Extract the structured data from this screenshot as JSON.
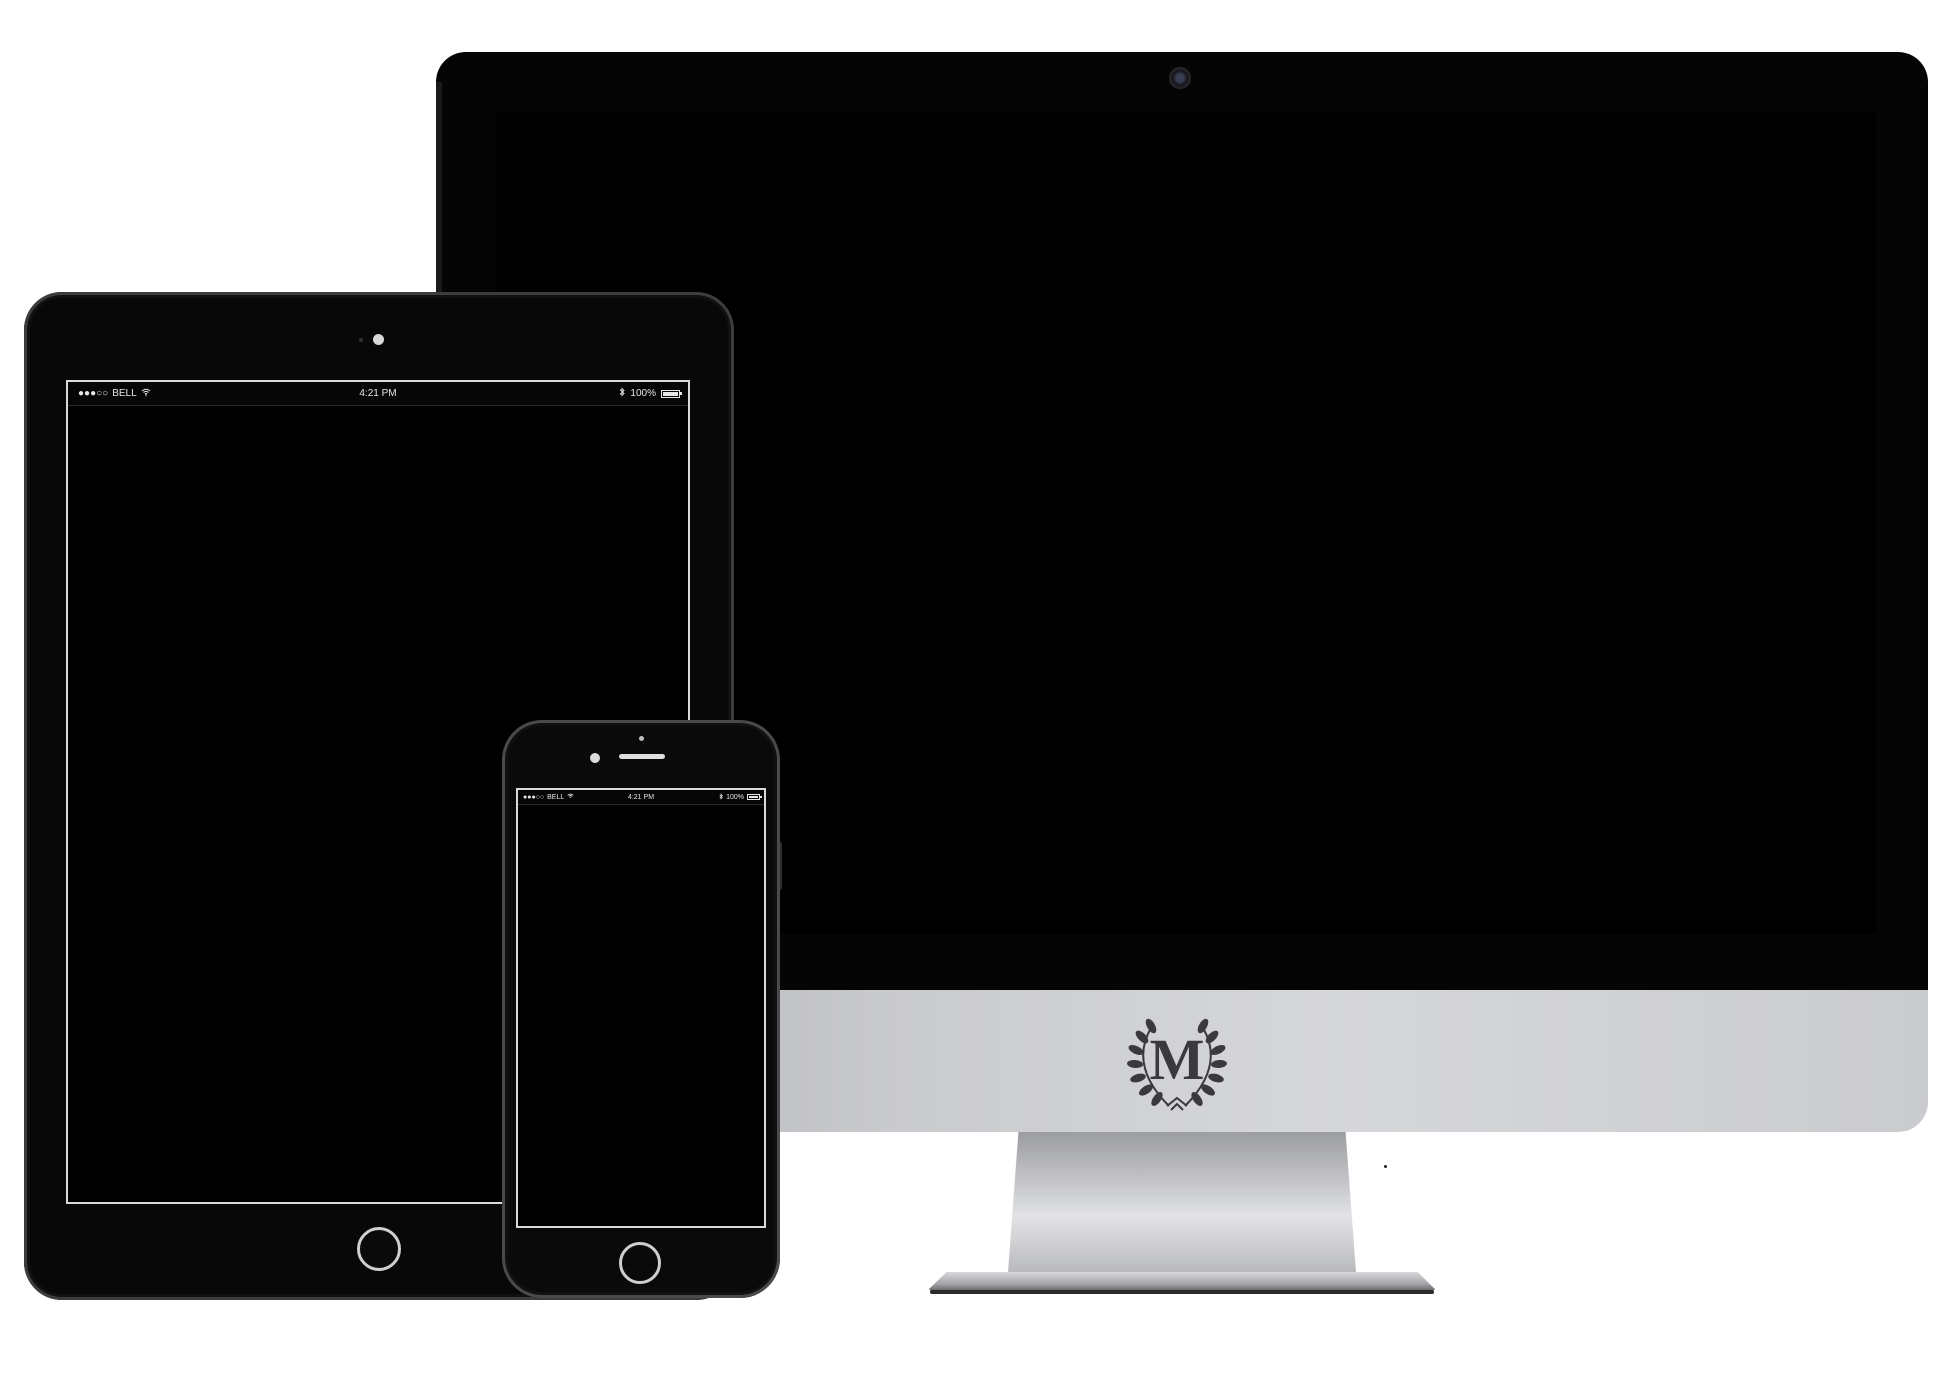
{
  "ipad": {
    "status_bar": {
      "signal": "●●●○○",
      "carrier": "BELL",
      "time": "4:21 PM",
      "battery": "100%"
    }
  },
  "iphone": {
    "status_bar": {
      "signal": "●●●○○",
      "carrier": "BELL",
      "time": "4:21 PM",
      "battery": "100%"
    }
  },
  "imac": {
    "logo_letter": "M"
  },
  "icons": [
    "wifi-icon",
    "bluetooth-icon",
    "battery-icon",
    "camera-icon",
    "home-button-icon",
    "laurel-wreath-logo-icon"
  ],
  "colors": {
    "screen": "#000000",
    "bezel": "#050505",
    "aluminum": "#c9cacd",
    "logo": "#3a3a3c"
  }
}
